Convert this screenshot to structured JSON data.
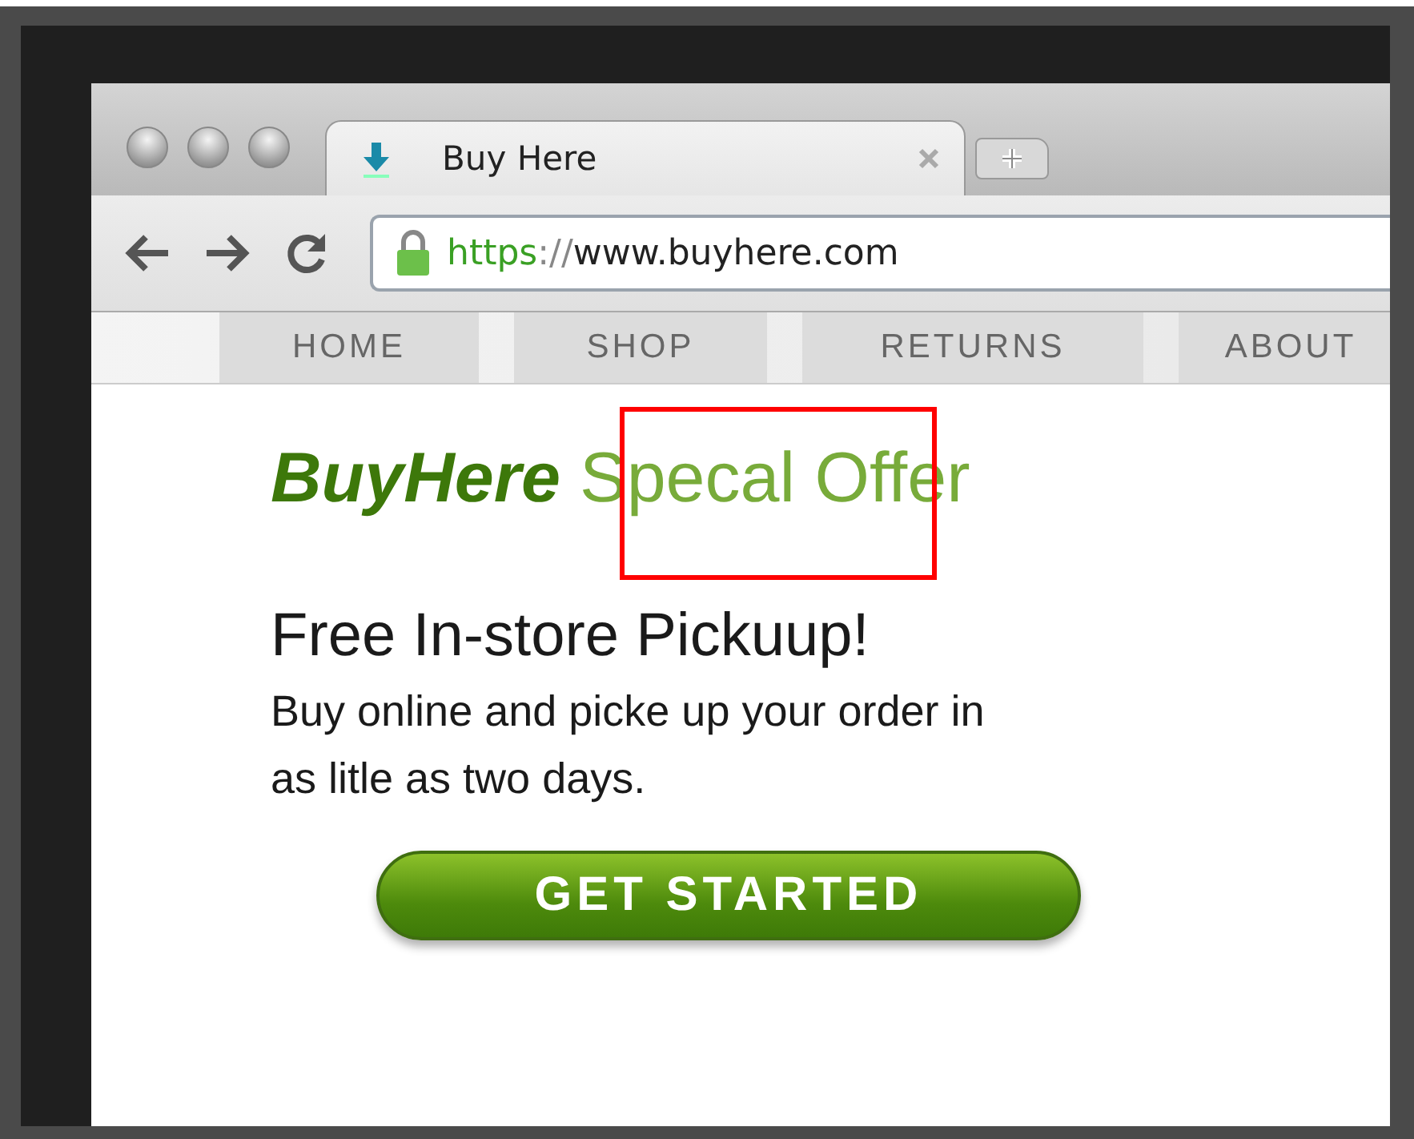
{
  "tab": {
    "title": "Buy Here",
    "selected": true
  },
  "address": {
    "scheme": "https",
    "separator": "://",
    "host": "www.buyhere.com"
  },
  "nav": [
    {
      "label": "HOME"
    },
    {
      "label": "SHOP"
    },
    {
      "label": "RETURNS"
    },
    {
      "label": "ABOUT"
    }
  ],
  "page": {
    "brand": "BuyHere",
    "headline": "Specal Offer",
    "subheading": "Free In-store Pickuup!",
    "body": "Buy online and picke up your order in as litle as two days.",
    "button": "GET STARTED"
  }
}
